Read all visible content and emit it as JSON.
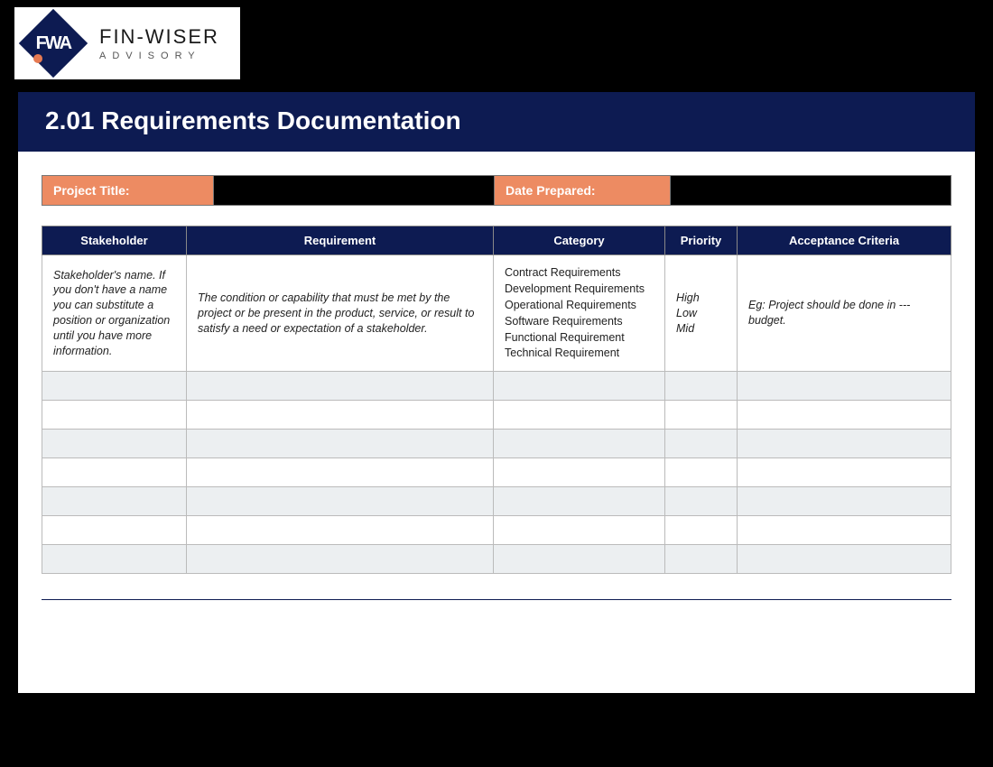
{
  "logo": {
    "mark": "FWA",
    "line1": "FIN-WISER",
    "line2": "ADVISORY"
  },
  "title": "2.01 Requirements Documentation",
  "meta": {
    "projectLabel": "Project Title:",
    "projectValue": "",
    "dateLabel": "Date Prepared:",
    "dateValue": ""
  },
  "table": {
    "headers": {
      "stakeholder": "Stakeholder",
      "requirement": "Requirement",
      "category": "Category",
      "priority": "Priority",
      "acceptance": "Acceptance Criteria"
    },
    "guidance": {
      "stakeholder": "Stakeholder's name. If you don't have a name you can substitute a position or organization until you have more information.",
      "requirement": "The condition or capability that must be met by the project or be present in the product, service, or result to satisfy a need or expectation of a stakeholder.",
      "categoryOptions": [
        "Contract Requirements",
        "Development Requirements",
        "Operational Requirements",
        "Software Requirements",
        "Functional Requirement",
        "Technical Requirement"
      ],
      "priorityOptions": [
        "High",
        "Low",
        "Mid"
      ],
      "acceptance": "Eg: Project should be done in --- budget."
    },
    "blankRows": 7
  }
}
